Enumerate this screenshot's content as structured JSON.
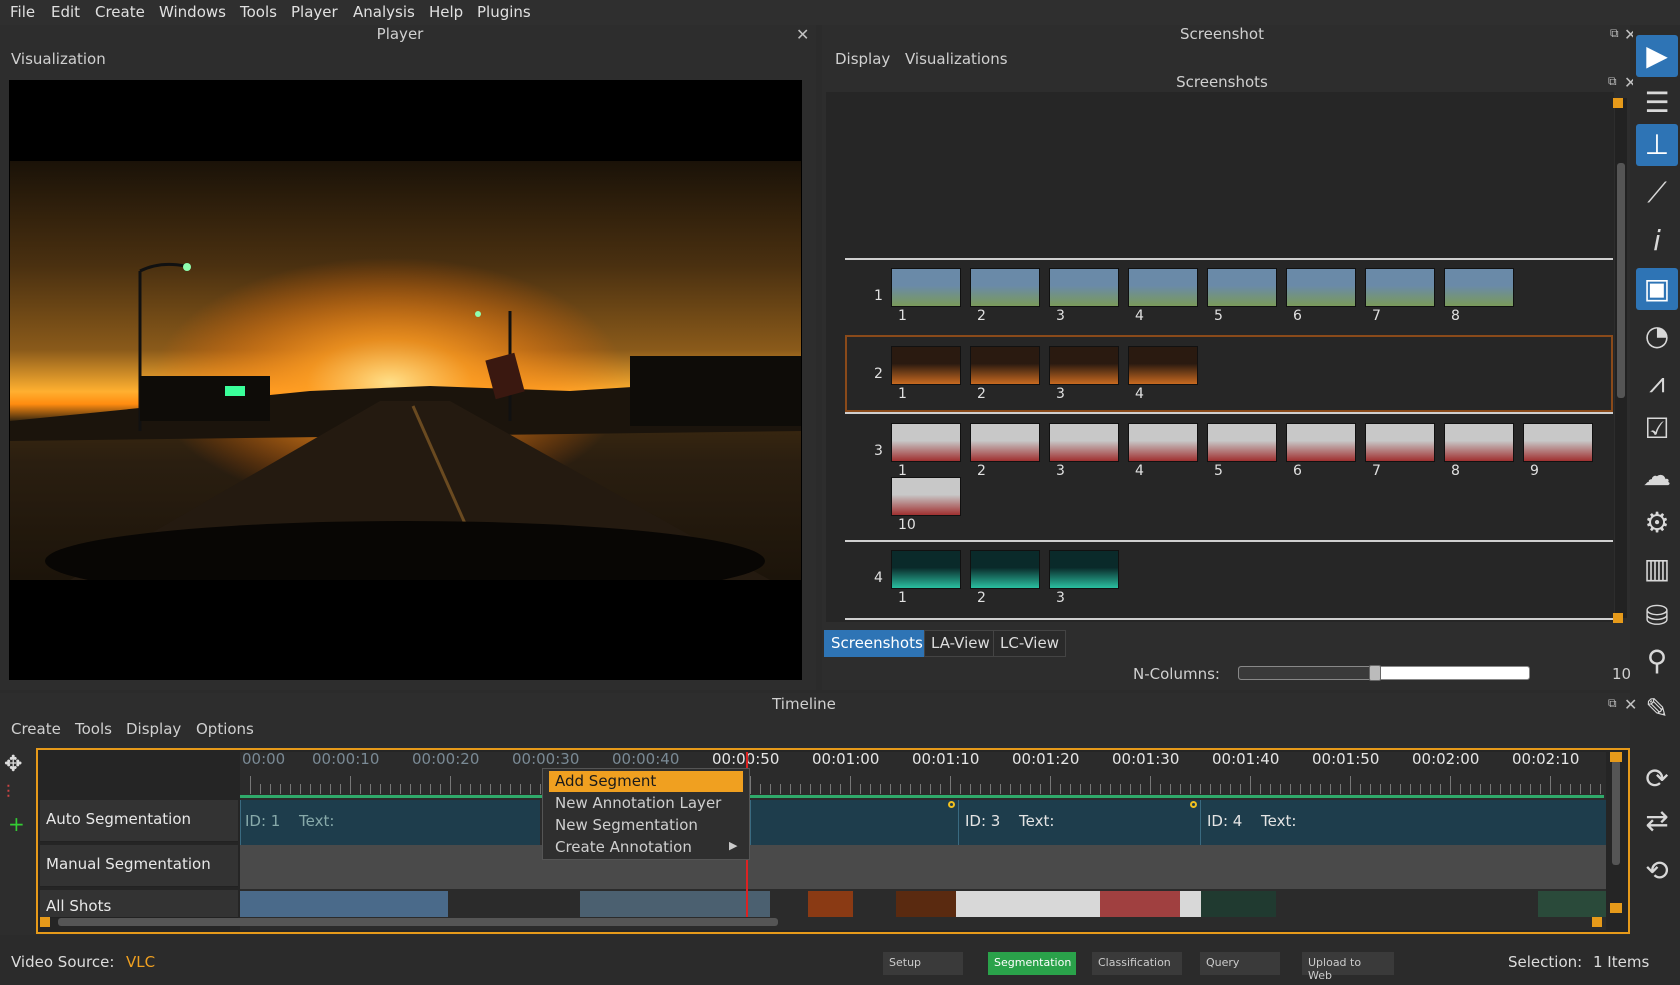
{
  "menubar": [
    "File",
    "Edit",
    "Create",
    "Windows",
    "Tools",
    "Player",
    "Analysis",
    "Help",
    "Plugins"
  ],
  "player": {
    "title": "Player",
    "sub": "Visualization"
  },
  "screenshot": {
    "title": "Screenshot",
    "sub_menu": [
      "Display",
      "Visualizations"
    ],
    "inner_title": "Screenshots",
    "rows": [
      {
        "id": "1",
        "thumbs": [
          "1",
          "2",
          "3",
          "4",
          "5",
          "6",
          "7",
          "8"
        ]
      },
      {
        "id": "2",
        "thumbs": [
          "1",
          "2",
          "3",
          "4"
        ]
      },
      {
        "id": "3",
        "thumbs": [
          "1",
          "2",
          "3",
          "4",
          "5",
          "6",
          "7",
          "8",
          "9",
          "10"
        ]
      },
      {
        "id": "4",
        "thumbs": [
          "1",
          "2",
          "3"
        ]
      }
    ],
    "tabs": [
      "Screenshots",
      "LA-View",
      "LC-View"
    ],
    "ncolumns_label": "N-Columns:",
    "ncolumns_value": "10",
    "slider_fraction": 0.47
  },
  "timeline": {
    "title": "Timeline",
    "menu": [
      "Create",
      "Tools",
      "Display",
      "Options"
    ],
    "ticks": [
      "00:00",
      "00:00:10",
      "00:00:20",
      "00:00:30",
      "00:00:40",
      "00:00:50",
      "00:01:00",
      "00:01:10",
      "00:01:20",
      "00:01:30",
      "00:01:40",
      "00:01:50",
      "00:02:00",
      "00:02:10"
    ],
    "layers": [
      "Auto Segmentation",
      "Manual Segmentation",
      "All Shots"
    ],
    "segments": [
      {
        "id": "ID: 1",
        "text": "Text:"
      },
      {
        "id": "ID: 3",
        "text": "Text:"
      },
      {
        "id": "ID: 4",
        "text": "Text:"
      }
    ],
    "context_menu": [
      "Add Segment",
      "New Annotation Layer",
      "New Segmentation",
      "Create Annotation"
    ]
  },
  "status": {
    "video_source_label": "Video Source:",
    "video_source_value": "VLC",
    "stages": [
      "Setup",
      "Segmentation",
      "Classification",
      "Query",
      "Upload to Web"
    ],
    "active_stage": "Segmentation",
    "selection_label": "Selection:",
    "selection_value": "1 Items"
  },
  "toolbar_icons": [
    "player-icon",
    "list-icon",
    "timeline-icon",
    "vocabulary-icon",
    "info-icon",
    "screenshot-icon",
    "chart-icon",
    "graph-icon",
    "checklist-icon",
    "upload-icon",
    "settings-icon",
    "library-icon",
    "database-icon",
    "search-icon",
    "edit-icon",
    "refresh-icon",
    "sync-icon",
    "pipeline-icon"
  ],
  "colors": {
    "accent": "#e69a1a",
    "selection_blue": "#2e74b5",
    "active_stage": "#2aa24a",
    "ruler": "#2faa6a"
  }
}
